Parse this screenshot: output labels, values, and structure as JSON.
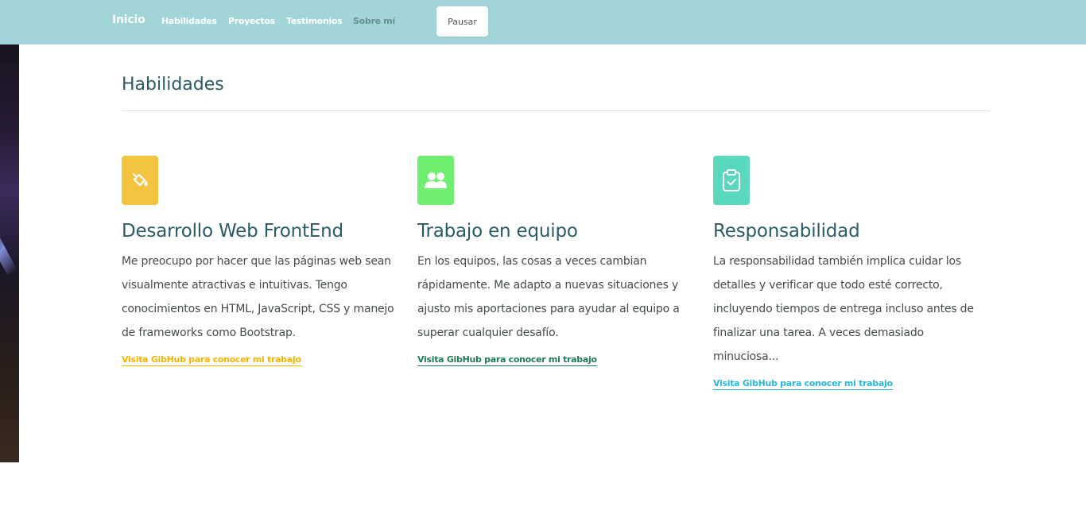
{
  "nav": {
    "brand": "Inicio",
    "links": [
      "Habilidades",
      "Proyectos",
      "Testimonios",
      "Sobre mí"
    ],
    "pause_label": "Pausar"
  },
  "section": {
    "title": "Habilidades"
  },
  "cards": [
    {
      "title": "Desarrollo Web FrontEnd",
      "text": "Me preocupo por hacer que las páginas web sean visualmente atractivas e intuitivas. Tengo conocimientos en HTML, JavaScript, CSS y manejo de frameworks como Bootstrap.",
      "link": "Visita GibHub para conocer mi trabajo",
      "icon": "paint-bucket-icon",
      "icon_color": "#f4c441",
      "link_color": "#f4b400"
    },
    {
      "title": "Trabajo en equipo",
      "text": "En los equipos, las cosas a veces cambian rápidamente. Me adapto a nuevas situaciones y ajusto mis aportaciones para ayudar al equipo a superar cualquier desafío.",
      "link": "Visita GibHub para conocer mi trabajo",
      "icon": "users-icon",
      "icon_color": "#6fee6f",
      "link_color": "#1f7a55"
    },
    {
      "title": "Responsabilidad",
      "text": "La responsabilidad también implica cuidar los detalles y verificar que todo esté correcto, incluyendo tiempos de entrega incluso antes de finalizar una tarea. A veces demasiado minuciosa...",
      "link": "Visita GibHub para conocer mi trabajo",
      "icon": "clipboard-check-icon",
      "icon_color": "#5ad8bd",
      "link_color": "#2ab8d8"
    }
  ]
}
